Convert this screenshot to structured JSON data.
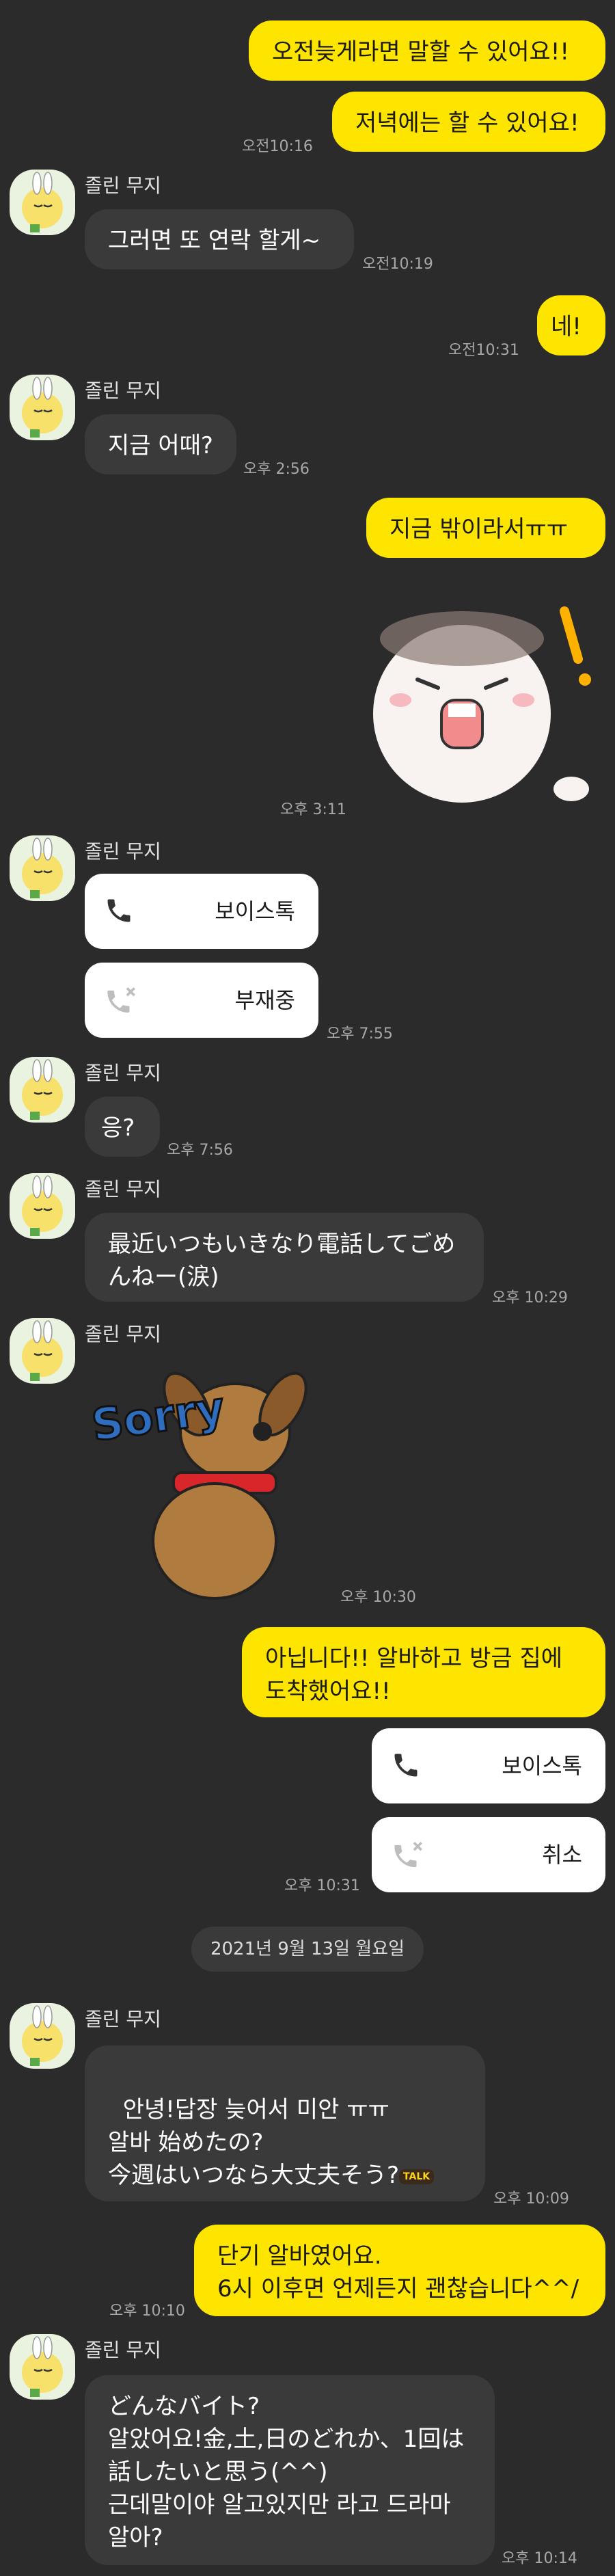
{
  "contact_name": "졸린 무지",
  "colors": {
    "background": "#2b2b2b",
    "my_bubble": "#fee500",
    "their_bubble": "#3a3a3a",
    "call_card": "#ffffff"
  },
  "messages": {
    "m1": {
      "text": "오전늦게라면 말할 수 있어요!!"
    },
    "m2": {
      "text": "저녁에는 할 수 있어요!",
      "time": "오전10:16"
    },
    "m3": {
      "text": "그러면 또 연락 할게~",
      "time": "오전10:19"
    },
    "m4": {
      "text": "네!",
      "time": "오전10:31"
    },
    "m5": {
      "text": "지금 어때?",
      "time": "오후 2:56"
    },
    "m6": {
      "text": "지금 밖이라서ㅠㅠ"
    },
    "m7": {
      "sticker": "angry-hamster-sticker",
      "time": "오후 3:11"
    },
    "m8": {
      "call_label": "보이스톡"
    },
    "m9": {
      "call_label": "부재중",
      "time": "오후 7:55"
    },
    "m10": {
      "text": "응?",
      "time": "오후 7:56"
    },
    "m11": {
      "text": "最近いつもいきなり電話してごめんねー(涙)",
      "time": "오후 10:29"
    },
    "m12": {
      "sticker": "sorry-dog-sticker",
      "sticker_text": "Sorry",
      "time": "오후 10:30"
    },
    "m13": {
      "text": "아닙니다!! 알바하고 방금 집에 도착했어요!!"
    },
    "m14": {
      "call_label": "보이스톡"
    },
    "m15": {
      "call_label": "취소",
      "time": "오후 10:31"
    },
    "date_divider": "2021년 9월 13일 월요일",
    "m16": {
      "text": "안녕!답장 늦어서 미안 ㅠㅠ\n알바 始めたの?\n今週はいつなら大丈夫そう?",
      "badge": "TALK",
      "time": "오후 10:09"
    },
    "m17": {
      "text": "단기 알바였어요.\n6시 이후면 언제든지 괜찮습니다^^/",
      "time": "오후 10:10"
    },
    "m18": {
      "text": "どんなバイト?\n알았어요!金,土,日のどれか、1回は話したいと思う(^^)\n근데말이야 알고있지만 라고 드라마 알아?",
      "time": "오후 10:14"
    }
  }
}
